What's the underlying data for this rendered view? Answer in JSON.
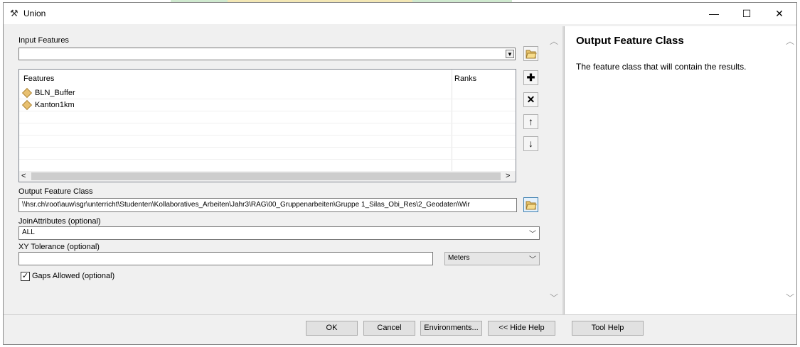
{
  "window": {
    "title": "Union",
    "minimize": "—",
    "maximize": "☐",
    "close": "✕"
  },
  "input_features": {
    "label": "Input Features",
    "value": ""
  },
  "features_table": {
    "headers": {
      "features": "Features",
      "ranks": "Ranks"
    },
    "rows": [
      {
        "feature": "BLN_Buffer",
        "rank": ""
      },
      {
        "feature": "Kanton1km",
        "rank": ""
      }
    ]
  },
  "side_buttons": {
    "add": "✚",
    "remove": "✕",
    "up": "🡅",
    "down": "🡇"
  },
  "output_feature_class": {
    "label": "Output Feature Class",
    "value": "\\\\hsr.ch\\root\\auw\\sgr\\unterricht\\Studenten\\Kollaboratives_Arbeiten\\Jahr3\\RAG\\00_Gruppenarbeiten\\Gruppe 1_Silas_Obi_Res\\2_Geodaten\\Wir"
  },
  "join_attributes": {
    "label": "JoinAttributes (optional)",
    "value": "ALL"
  },
  "xy_tolerance": {
    "label": "XY Tolerance (optional)",
    "value": "",
    "units": "Meters"
  },
  "gaps_allowed": {
    "label": "Gaps Allowed (optional)",
    "checked": true,
    "mark": "✓"
  },
  "help": {
    "title": "Output Feature Class",
    "text": "The feature class that will contain the results."
  },
  "buttons": {
    "ok": "OK",
    "cancel": "Cancel",
    "environments": "Environments...",
    "hide_help": "<< Hide Help",
    "tool_help": "Tool Help"
  },
  "icons": {
    "window_icon": "hammer-icon",
    "browse": "open-folder-icon",
    "layer": "feature-layer-icon"
  }
}
